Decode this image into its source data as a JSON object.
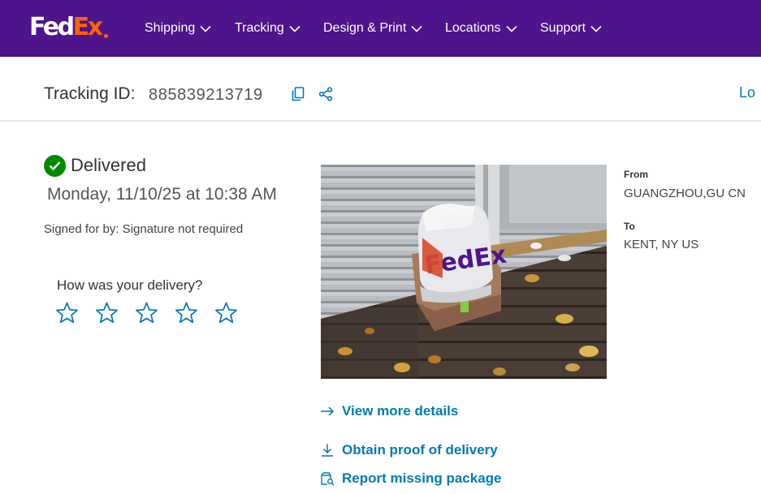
{
  "brand": {
    "logo_fed": "Fed",
    "logo_ex": "Ex"
  },
  "nav": [
    {
      "label": "Shipping"
    },
    {
      "label": "Tracking"
    },
    {
      "label": "Design & Print"
    },
    {
      "label": "Locations"
    },
    {
      "label": "Support"
    }
  ],
  "tracking": {
    "label": "Tracking ID:",
    "id": "885839213719",
    "right_link": "Lo"
  },
  "status": {
    "text": "Delivered",
    "date": "Monday, 11/10/25 at 10:38 AM",
    "signed": "Signed for by: Signature not required"
  },
  "rating": {
    "question": "How was your delivery?",
    "stars": 5,
    "selected": 0
  },
  "shipment": {
    "from_label": "From",
    "from_value": "GUANGZHOU,GU CN",
    "to_label": "To",
    "to_value": "KENT, NY US"
  },
  "photo": {
    "package_text": "FedEx"
  },
  "links": {
    "view_details": "View more details",
    "proof": "Obtain proof of delivery",
    "missing": "Report missing package"
  },
  "colors": {
    "brand_purple": "#4d148c",
    "brand_orange": "#ff6200",
    "link_blue": "#007ab7",
    "success_green": "#008a00"
  }
}
